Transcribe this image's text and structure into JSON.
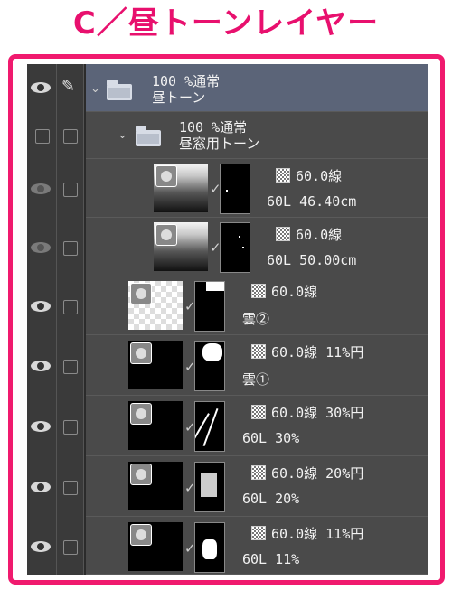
{
  "heading": "C／昼トーンレイヤー",
  "colors": {
    "accent": "#f01a6e",
    "panel": "#4a4a4a",
    "folder_selected": "#5b6478"
  },
  "layers": [
    {
      "kind": "folder",
      "line1": "100 %通常",
      "line2": "昼トーン",
      "eye_icon": "eye-icon",
      "lock_icon": "pen-icon"
    },
    {
      "kind": "folder",
      "line1": "100 %通常",
      "line2": "昼窓用トーン"
    },
    {
      "kind": "layer",
      "line1": "60.0線",
      "line2": "60L 46.40cm"
    },
    {
      "kind": "layer",
      "line1": "60.0線",
      "line2": "60L 50.00cm"
    },
    {
      "kind": "layer",
      "line1": "60.0線",
      "line2": "雲②"
    },
    {
      "kind": "layer",
      "line1": "60.0線 11%円",
      "line2": "雲①"
    },
    {
      "kind": "layer",
      "line1": "60.0線 30%円",
      "line2": "60L 30%"
    },
    {
      "kind": "layer",
      "line1": "60.0線 20%円",
      "line2": "60L 20%"
    },
    {
      "kind": "layer",
      "line1": "60.0線 11%円",
      "line2": "60L 11%"
    }
  ]
}
